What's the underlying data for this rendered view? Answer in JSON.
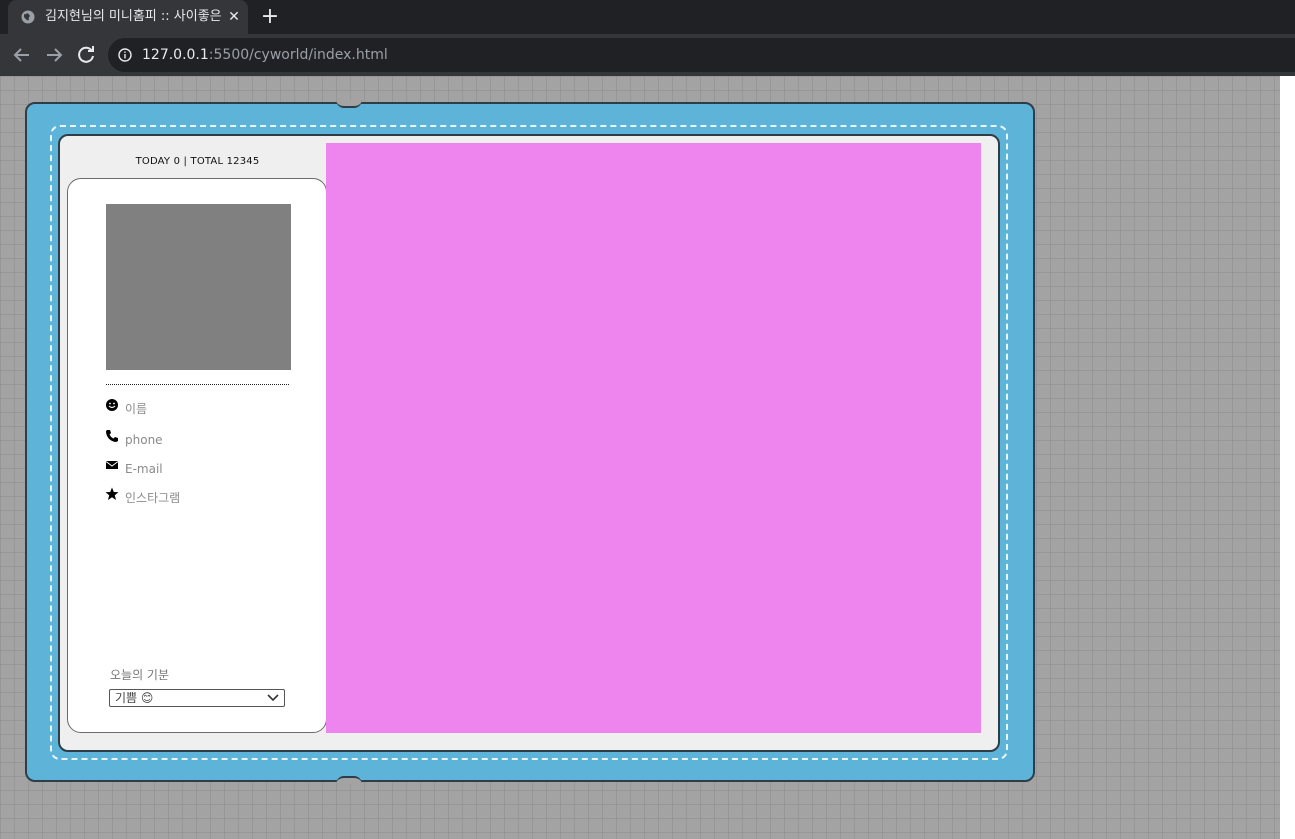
{
  "browser": {
    "tab_title": "김지현님의 미니홈피 :: 사이좋은 사람들",
    "tab_close": "✕",
    "new_tab": "+",
    "url_host": "127.0.0.1",
    "url_path": ":5500/cyworld/index.html"
  },
  "page": {
    "counter": "TODAY 0 | TOTAL 12345",
    "profile": {
      "items": [
        {
          "icon": "smile-icon",
          "label": "이름"
        },
        {
          "icon": "phone-icon",
          "label": "phone"
        },
        {
          "icon": "envelope-icon",
          "label": "E-mail"
        },
        {
          "icon": "star-icon",
          "label": "인스타그램"
        }
      ]
    },
    "mood": {
      "label": "오늘의 기분",
      "selected": "기쁨 😊"
    }
  },
  "colors": {
    "notebook_blue": "#5db3d8",
    "main_panel": "#ee85ee",
    "photo": "#808080",
    "background": "#a3a3a3"
  }
}
